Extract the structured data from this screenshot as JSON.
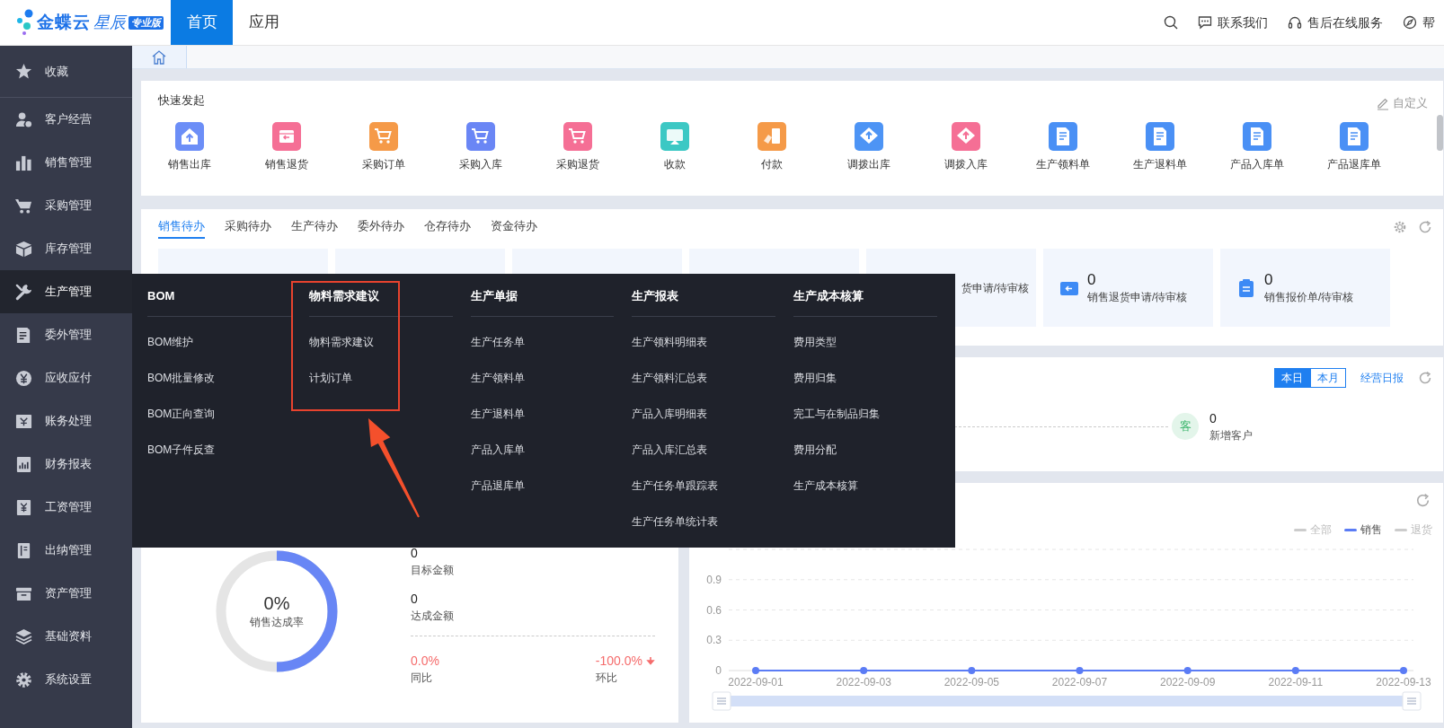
{
  "header": {
    "logo": {
      "name": "金蝶云",
      "product": "星辰",
      "edition": "专业版"
    },
    "nav": [
      {
        "label": "首页",
        "selected": true
      },
      {
        "label": "应用",
        "selected": false
      }
    ],
    "actions": [
      {
        "label": "联系我们"
      },
      {
        "label": "售后在线服务"
      },
      {
        "label": "帮"
      }
    ]
  },
  "sidebar": {
    "items": [
      {
        "label": "收藏",
        "selected": false
      },
      {
        "label": "客户经营",
        "selected": false
      },
      {
        "label": "销售管理",
        "selected": false
      },
      {
        "label": "采购管理",
        "selected": false
      },
      {
        "label": "库存管理",
        "selected": false
      },
      {
        "label": "生产管理",
        "selected": true
      },
      {
        "label": "委外管理",
        "selected": false
      },
      {
        "label": "应收应付",
        "selected": false
      },
      {
        "label": "账务处理",
        "selected": false
      },
      {
        "label": "财务报表",
        "selected": false
      },
      {
        "label": "工资管理",
        "selected": false
      },
      {
        "label": "出纳管理",
        "selected": false
      },
      {
        "label": "资产管理",
        "selected": false
      },
      {
        "label": "基础资料",
        "selected": false
      },
      {
        "label": "系统设置",
        "selected": false
      }
    ]
  },
  "quick_launch": {
    "title": "快速发起",
    "customize": "自定义",
    "items": [
      {
        "label": "销售出库",
        "kind": "outbound",
        "color": "#6c8ef7"
      },
      {
        "label": "销售退货",
        "kind": "box",
        "color": "#f56f95"
      },
      {
        "label": "采购订单",
        "kind": "cart",
        "color": "#f59a48"
      },
      {
        "label": "采购入库",
        "kind": "cart",
        "color": "#6a86f5"
      },
      {
        "label": "采购退货",
        "kind": "cart",
        "color": "#f56f95"
      },
      {
        "label": "收款",
        "kind": "receipt",
        "color": "#3cc8c4"
      },
      {
        "label": "付款",
        "kind": "payment",
        "color": "#f59a48"
      },
      {
        "label": "调拨出库",
        "kind": "transfer",
        "color": "#4d94f5"
      },
      {
        "label": "调拨入库",
        "kind": "transfer",
        "color": "#f56f95"
      },
      {
        "label": "生产领料单",
        "kind": "document",
        "color": "#4a90f5"
      },
      {
        "label": "生产退料单",
        "kind": "document",
        "color": "#4a90f5"
      },
      {
        "label": "产品入库单",
        "kind": "document",
        "color": "#4a90f5"
      },
      {
        "label": "产品退库单",
        "kind": "document",
        "color": "#4a90f5"
      }
    ]
  },
  "todo": {
    "tabs": [
      {
        "label": "销售待办",
        "selected": true
      },
      {
        "label": "采购待办",
        "selected": false
      },
      {
        "label": "生产待办",
        "selected": false
      },
      {
        "label": "委外待办",
        "selected": false
      },
      {
        "label": "仓存待办",
        "selected": false
      },
      {
        "label": "资金待办",
        "selected": false
      }
    ],
    "cards": [
      {
        "kind": "blank"
      },
      {
        "kind": "blank"
      },
      {
        "kind": "blank"
      },
      {
        "kind": "blank"
      },
      {
        "kind": "partial",
        "label": "货申请/待审核"
      },
      {
        "kind": "full",
        "count": "0",
        "label": "销售退货申请/待审核"
      },
      {
        "kind": "full",
        "count": "0",
        "label": "销售报价单/待审核"
      }
    ]
  },
  "overview": {
    "periods": [
      {
        "label": "本日",
        "selected": true
      },
      {
        "label": "本月",
        "selected": false
      }
    ],
    "report_link": "经营日报",
    "new_customers": {
      "avatar": "客",
      "count": "0",
      "label": "新增客户"
    }
  },
  "achievement": {
    "level": 0.5,
    "rate": "0%",
    "rate_label": "销售达成率",
    "target": {
      "value": "0",
      "label": "目标金额"
    },
    "achieved": {
      "value": "0",
      "label": "达成金额"
    },
    "yoy": {
      "value": "0.0%",
      "label": "同比"
    },
    "mom": {
      "value": "-100.0%",
      "label": "环比",
      "declining": true
    }
  },
  "trend": {
    "legend": [
      {
        "kind": "option",
        "label": "全部",
        "on": false
      },
      {
        "kind": "series",
        "on": true
      },
      {
        "kind": "option",
        "label": "退货",
        "on": false
      }
    ],
    "chart_data": {
      "type": "line",
      "categories": [
        "2022-09-01",
        "2022-09-03",
        "2022-09-05",
        "2022-09-07",
        "2022-09-09",
        "2022-09-11",
        "2022-09-13"
      ],
      "series": [
        {
          "name": "销售",
          "color": "#5b7cf5",
          "marker": "circle",
          "values": [
            0,
            0,
            0,
            0,
            0,
            0,
            0
          ]
        }
      ],
      "ylim": [
        0,
        1.2
      ],
      "yticks": [
        0,
        0.3,
        0.6,
        0.9
      ],
      "grid": true
    }
  },
  "mega_menu": {
    "columns": [
      {
        "title": "BOM",
        "highlighted": false,
        "items": [
          "BOM维护",
          "BOM批量修改",
          "BOM正向查询",
          "BOM子件反查"
        ]
      },
      {
        "title": "物料需求建议",
        "highlighted": true,
        "items": [
          "物料需求建议",
          "计划订单"
        ]
      },
      {
        "title": "生产单据",
        "highlighted": false,
        "items": [
          "生产任务单",
          "生产领料单",
          "生产退料单",
          "产品入库单",
          "产品退库单"
        ]
      },
      {
        "title": "生产报表",
        "highlighted": false,
        "items": [
          "生产领料明细表",
          "生产领料汇总表",
          "产品入库明细表",
          "产品入库汇总表",
          "生产任务单跟踪表",
          "生产任务单统计表"
        ]
      },
      {
        "title": "生产成本核算",
        "highlighted": false,
        "items": [
          "费用类型",
          "费用归集",
          "完工与在制品归集",
          "费用分配",
          "生产成本核算"
        ]
      }
    ]
  }
}
